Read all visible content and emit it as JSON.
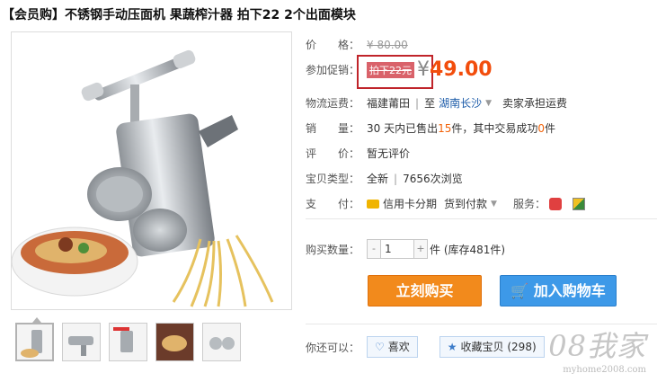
{
  "title": "【会员购】不锈钢手动压面机 果蔬榨汁器 拍下22 2个出面模块",
  "price": {
    "label": "价　　格：",
    "original": "¥ 80.00"
  },
  "promo": {
    "label": "参加促销：",
    "tag": "拍下22元",
    "symbol": "¥",
    "value": "49.00"
  },
  "shipping": {
    "label": "物流运费：",
    "from": "福建莆田",
    "divider": "|",
    "to_prefix": "至",
    "to": "湖南长沙",
    "note": "卖家承担运费"
  },
  "sales": {
    "label": "销　　量：",
    "prefix": "30 天内已售出 ",
    "count": "15",
    "middle": " 件，其中交易成功 ",
    "success": "0",
    "suffix": " 件"
  },
  "review": {
    "label": "评　　价：",
    "value": "暂无评价"
  },
  "type": {
    "label": "宝贝类型：",
    "value": "全新",
    "divider": "|",
    "views": "7656次浏览"
  },
  "payment": {
    "label": "支　　付：",
    "credit": "信用卡分期",
    "cod": "货到付款",
    "service_label": "服务："
  },
  "quantity": {
    "label": "购买数量：",
    "value": "1",
    "minus": "-",
    "plus": "+",
    "unit": "件 (库存481件)"
  },
  "actions": {
    "buy": "立刻购买",
    "cart": "加入购物车"
  },
  "extra": {
    "label": "你还可以：",
    "like": "喜欢",
    "fav": "收藏宝贝 (298)"
  },
  "watermark": {
    "big": "08我家",
    "small": "myhome2008.com"
  },
  "colors": {
    "accent": "#f24d0c",
    "buy": "#f28a1c",
    "cart": "#3d99e8",
    "promo_border": "#c0242a"
  },
  "icons": [
    "credit-card-icon",
    "service-gift-icon",
    "service-shield-icon",
    "cart-icon",
    "heart-icon",
    "star-icon"
  ]
}
